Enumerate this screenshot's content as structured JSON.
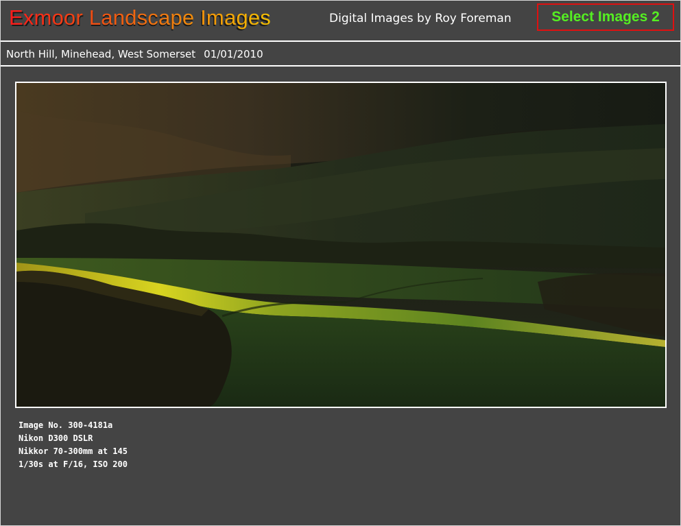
{
  "header": {
    "site_title": "Exmoor Landscape Images",
    "subtitle": "Digital Images by Roy Foreman",
    "select_button": "Select Images 2"
  },
  "location": {
    "place": "North Hill, Minehead, West Somerset",
    "date": "01/01/2010"
  },
  "photo": {
    "subject": "landscape-photo"
  },
  "details": {
    "image_no": "Image No. 300-4181a",
    "camera": "Nikon D300 DSLR",
    "lens": "Nikkor 70-300mm at 145",
    "exposure": "1/30s at F/16, ISO 200"
  },
  "colors": {
    "background": "#444444",
    "select_button_text": "#55ee22",
    "select_button_border": "#e01010"
  }
}
